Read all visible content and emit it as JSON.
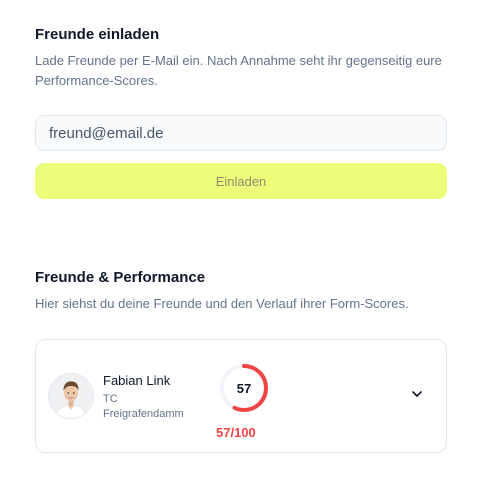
{
  "invite": {
    "title": "Freunde einladen",
    "description": "Lade Freunde per E-Mail ein. Nach Annahme seht ihr gegenseitig eure Performance-Scores.",
    "email_placeholder": "freund@email.de",
    "button_label": "Einladen"
  },
  "friends": {
    "title": "Freunde & Performance",
    "description": "Hier siehst du deine Freunde und den Verlauf ihrer Form-Scores.",
    "list": [
      {
        "name": "Fabian Link",
        "club_line1": "TC",
        "club_line2": "Freigrafendamm",
        "score": "57",
        "score_label": "57/100",
        "score_fraction": 0.57
      }
    ]
  },
  "colors": {
    "accent_button": "#ecfd7a",
    "score_red": "#ef4444"
  }
}
